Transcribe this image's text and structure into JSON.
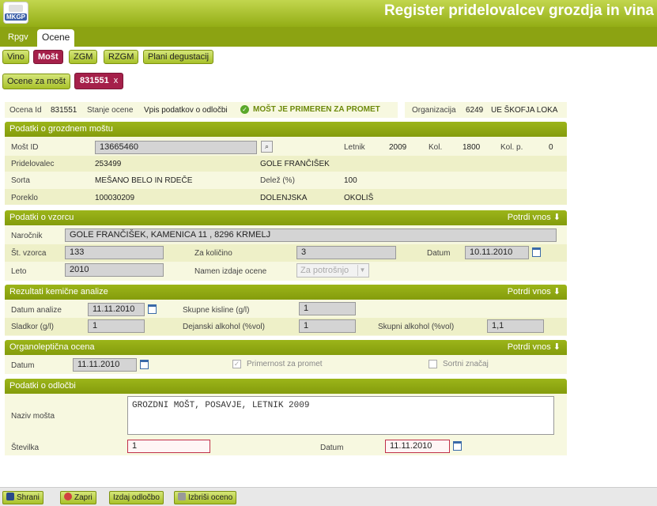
{
  "app": {
    "logo_text": "MKGP",
    "title": "Register pridelovalcev grozdja in vina"
  },
  "tabs": [
    "Rpgv",
    "Ocene"
  ],
  "subnav": [
    "Vino",
    "Mošt",
    "ZGM",
    "RZGM",
    "Plani degustacij"
  ],
  "breadcrumb": {
    "ocene_label": "Ocene za mošt",
    "record_tab": "831551",
    "close": "x"
  },
  "summary": {
    "ocena_id_label": "Ocena Id",
    "ocena_id": "831551",
    "stanje_label": "Stanje ocene",
    "stanje": "Vpis podatkov o odločbi",
    "status": "MOŠT JE PRIMEREN ZA PROMET",
    "org_label": "Organizacija",
    "org_code": "6249",
    "org_name": "UE ŠKOFJA LOKA"
  },
  "grozdni": {
    "title": "Podatki o grozdnem moštu",
    "most_id_label": "Mošt ID",
    "most_id": "13665460",
    "letnik_label": "Letnik",
    "letnik": "2009",
    "kol_label": "Kol.",
    "kol": "1800",
    "kolp_label": "Kol. p.",
    "kolp": "0",
    "prid_label": "Pridelovalec",
    "prid_id": "253499",
    "prid_name": "GOLE FRANČIŠEK",
    "sorta_label": "Sorta",
    "sorta": "MEŠANO BELO IN RDEČE",
    "delez_label": "Delež (%)",
    "delez": "100",
    "poreklo_label": "Poreklo",
    "poreklo_id": "100030209",
    "poreklo_reg": "DOLENJSKA",
    "poreklo_okolis": "OKOLIŠ"
  },
  "vzorec": {
    "title": "Podatki o vzorcu",
    "potrdi": "Potrdi vnos",
    "narocnik_label": "Naročnik",
    "narocnik": "GOLE FRANČIŠEK, KAMENICA 11 , 8296 KRMELJ",
    "st_label": "Št. vzorca",
    "st": "133",
    "zakol_label": "Za količino",
    "zakol": "3",
    "datum_label": "Datum",
    "datum": "10.11.2010",
    "leto_label": "Leto",
    "leto": "2010",
    "namen_label": "Namen izdaje ocene",
    "namen": "Za potrošnjo"
  },
  "kemicne": {
    "title": "Rezultati kemične analize",
    "potrdi": "Potrdi vnos",
    "datum_label": "Datum analize",
    "datum": "11.11.2010",
    "kisline_label": "Skupne kisline (g/l)",
    "kisline": "1",
    "sladkor_label": "Sladkor (g/l)",
    "sladkor": "1",
    "dejalk_label": "Dejanski alkohol (%vol)",
    "dejalk": "1",
    "skalk_label": "Skupni alkohol (%vol)",
    "skalk": "1,1"
  },
  "organo": {
    "title": "Organoleptična ocena",
    "potrdi": "Potrdi vnos",
    "datum_label": "Datum",
    "datum": "11.11.2010",
    "primernost_label": "Primernost za promet",
    "sortni_label": "Sortni značaj"
  },
  "odlocba": {
    "title": "Podatki o odločbi",
    "naziv_label": "Naziv mošta",
    "naziv": "GROZDNI MOŠT, POSAVJE, LETNIK 2009",
    "stevilka_label": "Številka",
    "stevilka": "1",
    "datum_label": "Datum",
    "datum": "11.11.2010"
  },
  "footer": [
    "Shrani",
    "Zapri",
    "Izdaj odločbo",
    "Izbriši oceno"
  ]
}
